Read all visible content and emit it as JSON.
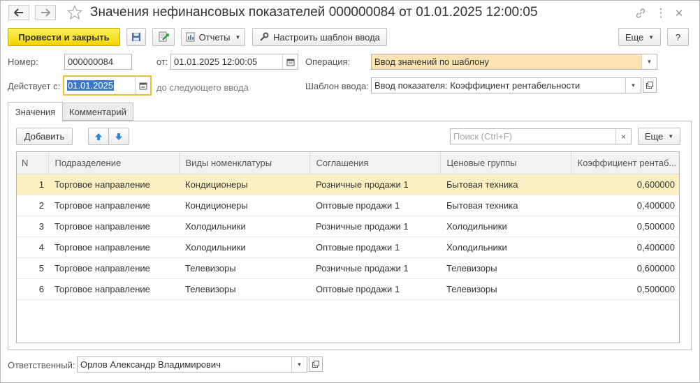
{
  "window": {
    "title": "Значения нефинансовых показателей 000000084 от 01.01.2025 12:00:05"
  },
  "toolbar": {
    "post_close_label": "Провести и закрыть",
    "reports_label": "Отчеты",
    "template_label": "Настроить шаблон ввода",
    "more_label": "Еще",
    "help_label": "?"
  },
  "form": {
    "number_label": "Номер:",
    "number_value": "000000084",
    "date_label": "от:",
    "date_value": "01.01.2025 12:00:05",
    "operation_label": "Операция:",
    "operation_value": "Ввод значений по шаблону",
    "valid_from_label": "Действует с:",
    "valid_from_value": "01.01.2025",
    "until_text": "до следующего ввода",
    "template_label": "Шаблон ввода:",
    "template_value": "Ввод показателя: Коэффициент рентабельности"
  },
  "tabs": [
    {
      "label": "Значения",
      "active": true
    },
    {
      "label": "Комментарий",
      "active": false
    }
  ],
  "table_toolbar": {
    "add_label": "Добавить",
    "search_placeholder": "Поиск (Ctrl+F)",
    "clear_label": "×",
    "more_label": "Еще"
  },
  "table": {
    "columns": [
      "N",
      "Подразделение",
      "Виды номенклатуры",
      "Соглашения",
      "Ценовые группы",
      "Коэффициент рентаб..."
    ],
    "rows": [
      {
        "n": "1",
        "dept": "Торговое направление",
        "kind": "Кондиционеры",
        "agreement": "Розничные продажи 1",
        "group": "Бытовая техника",
        "coef": "0,600000",
        "selected": true
      },
      {
        "n": "2",
        "dept": "Торговое направление",
        "kind": "Кондиционеры",
        "agreement": "Оптовые продажи 1",
        "group": "Бытовая техника",
        "coef": "0,400000",
        "selected": false
      },
      {
        "n": "3",
        "dept": "Торговое направление",
        "kind": "Холодильники",
        "agreement": "Розничные продажи 1",
        "group": "Холодильники",
        "coef": "0,500000",
        "selected": false
      },
      {
        "n": "4",
        "dept": "Торговое направление",
        "kind": "Холодильники",
        "agreement": "Оптовые продажи 1",
        "group": "Холодильники",
        "coef": "0,400000",
        "selected": false
      },
      {
        "n": "5",
        "dept": "Торговое направление",
        "kind": "Телевизоры",
        "agreement": "Розничные продажи 1",
        "group": "Телевизоры",
        "coef": "0,600000",
        "selected": false
      },
      {
        "n": "6",
        "dept": "Торговое направление",
        "kind": "Телевизоры",
        "agreement": "Оптовые продажи 1",
        "group": "Телевизоры",
        "coef": "0,500000",
        "selected": false
      }
    ]
  },
  "footer": {
    "responsible_label": "Ответственный:",
    "responsible_value": "Орлов Александр Владимирович"
  },
  "colors": {
    "primary_button": "#f3d300",
    "selected_row": "#fdf0c3",
    "operation_field": "#fbe4b1",
    "focus_border": "#e8c33a",
    "arrow_blue": "#2a86d6"
  }
}
